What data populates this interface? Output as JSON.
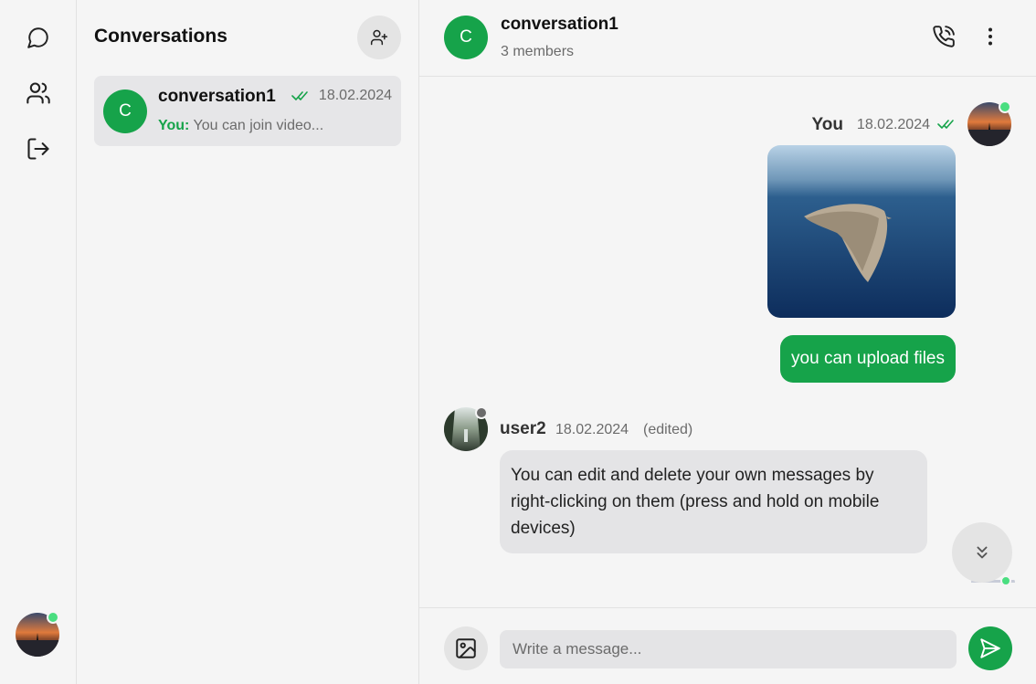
{
  "colors": {
    "accent": "#16a34a",
    "online": "#4ade80",
    "offline": "#6b6b6b"
  },
  "sidebar": {
    "icons": [
      "message-circle-icon",
      "users-icon",
      "logout-icon"
    ]
  },
  "conversations": {
    "title": "Conversations",
    "items": [
      {
        "initial": "C",
        "name": "conversation1",
        "date": "18.02.2024",
        "preview_author": "You:",
        "preview_text": "You can join video..."
      }
    ]
  },
  "chat": {
    "header": {
      "initial": "C",
      "name": "conversation1",
      "members": "3 members"
    },
    "messages": [
      {
        "author": "You",
        "date": "18.02.2024",
        "type": "image",
        "read": true
      },
      {
        "author": "You",
        "type": "text",
        "text": "you can upload files"
      },
      {
        "author": "user2",
        "date": "18.02.2024",
        "edited": "(edited)",
        "type": "text",
        "text": "You can edit and delete your own messages by right-clicking on them (press and hold on mobile devices)"
      }
    ],
    "composer": {
      "placeholder": "Write a message..."
    }
  }
}
